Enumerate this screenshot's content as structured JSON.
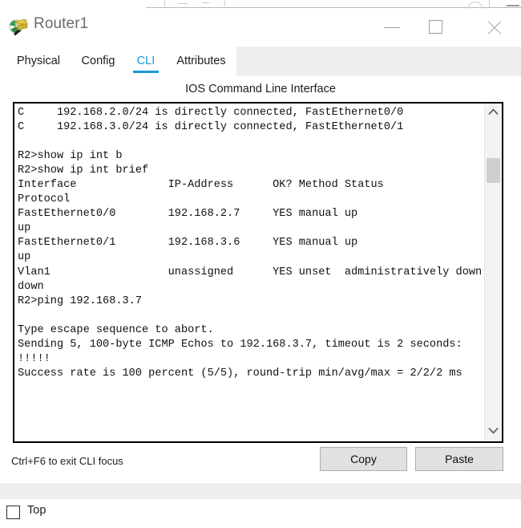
{
  "window": {
    "title": "Router1",
    "icon": "packet-tracer-router-icon",
    "controls": {
      "minimize": "minimize-icon",
      "maximize": "maximize-icon",
      "close": "close-icon"
    }
  },
  "tabs": [
    {
      "label": "Physical",
      "active": false
    },
    {
      "label": "Config",
      "active": false
    },
    {
      "label": "CLI",
      "active": true
    },
    {
      "label": "Attributes",
      "active": false
    }
  ],
  "panel": {
    "header": "IOS Command Line Interface",
    "hint": "Ctrl+F6 to exit CLI focus",
    "copy_label": "Copy",
    "paste_label": "Paste"
  },
  "terminal": {
    "lines": [
      "C     192.168.2.0/24 is directly connected, FastEthernet0/0",
      "C     192.168.3.0/24 is directly connected, FastEthernet0/1",
      "",
      "R2>show ip int b",
      "R2>show ip int brief",
      "Interface              IP-Address      OK? Method Status                Protocol",
      "FastEthernet0/0        192.168.2.7     YES manual up                    up",
      "FastEthernet0/1        192.168.3.6     YES manual up                    up",
      "Vlan1                  unassigned      YES unset  administratively down down",
      "R2>ping 192.168.3.7",
      "",
      "Type escape sequence to abort.",
      "Sending 5, 100-byte ICMP Echos to 192.168.3.7, timeout is 2 seconds:",
      "!!!!!",
      "Success rate is 100 percent (5/5), round-trip min/avg/max = 2/2/2 ms"
    ],
    "scrollbar": {
      "up_arrow": "chevron-up-icon",
      "down_arrow": "chevron-down-icon",
      "thumb_position_percent": 16
    }
  },
  "bottom": {
    "top_checkbox_label": "Top",
    "top_checkbox_checked": false
  },
  "colors": {
    "accent": "#169bd5",
    "tabstrip_bg": "#efefef",
    "button_face": "#e1e1e1",
    "terminal_border": "#000000"
  }
}
